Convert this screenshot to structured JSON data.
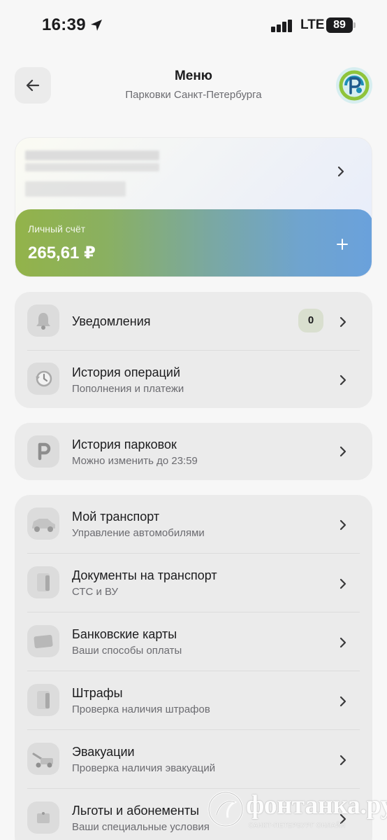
{
  "status_bar": {
    "time": "16:39",
    "network": "LTE",
    "battery": "89"
  },
  "header": {
    "title": "Меню",
    "subtitle": "Парковки Санкт-Петербурга"
  },
  "account": {
    "balance_label": "Личный счёт",
    "balance_value": "265,61 ₽"
  },
  "groups": [
    {
      "items": [
        {
          "title": "Уведомления",
          "subtitle": "",
          "badge": "0",
          "icon": "bell-icon"
        },
        {
          "title": "История операций",
          "subtitle": "Пополнения и платежи",
          "icon": "history-clock-icon"
        }
      ]
    },
    {
      "items": [
        {
          "title": "История парковок",
          "subtitle": "Можно изменить до 23:59",
          "icon": "parking-icon"
        }
      ]
    },
    {
      "items": [
        {
          "title": "Мой транспорт",
          "subtitle": "Управление автомобилями",
          "icon": "car-icon"
        },
        {
          "title": "Документы на транспорт",
          "subtitle": "СТС и ВУ",
          "icon": "document-icon"
        },
        {
          "title": "Банковские карты",
          "subtitle": "Ваши способы оплаты",
          "icon": "bank-card-icon"
        },
        {
          "title": "Штрафы",
          "subtitle": "Проверка наличия штрафов",
          "icon": "fines-icon"
        },
        {
          "title": "Эвакуации",
          "subtitle": "Проверка наличия эвакуаций",
          "icon": "tow-truck-icon"
        },
        {
          "title": "Льготы и абонементы",
          "subtitle": "Ваши специальные условия",
          "icon": "ticket-icon"
        }
      ]
    }
  ],
  "watermark": {
    "text": "фонтанка.ру",
    "subtext": "САНКТ-ПЕТЕРБУРГ ОНЛАЙН"
  },
  "colors": {
    "balance_gradient_start": "#93b34a",
    "balance_gradient_end": "#6aa1dc",
    "background": "#f7f7f7",
    "group_background": "#ebebeb"
  }
}
